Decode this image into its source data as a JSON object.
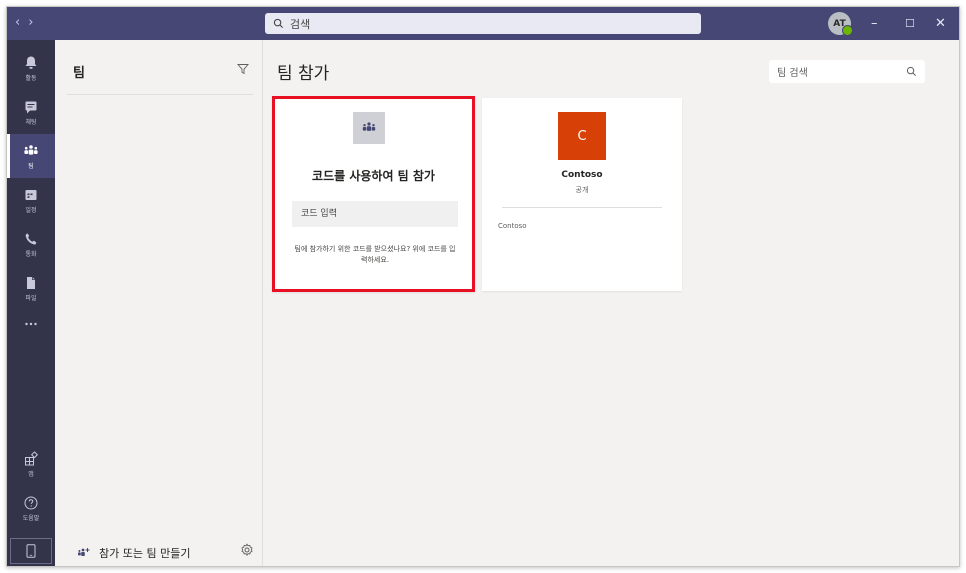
{
  "titlebar": {
    "search_placeholder": "검색",
    "avatar_initials": "AT"
  },
  "rail": {
    "items": [
      {
        "label": "활동",
        "icon": "bell-icon"
      },
      {
        "label": "채팅",
        "icon": "chat-icon"
      },
      {
        "label": "팀",
        "icon": "teams-icon",
        "active": true
      },
      {
        "label": "일정",
        "icon": "calendar-icon"
      },
      {
        "label": "통화",
        "icon": "phone-icon"
      },
      {
        "label": "파일",
        "icon": "file-icon"
      },
      {
        "label": "",
        "icon": "more-icon"
      },
      {
        "label": "앱",
        "icon": "apps-icon"
      },
      {
        "label": "도움말",
        "icon": "help-icon"
      }
    ]
  },
  "list": {
    "title": "팀",
    "join_create_label": "참가 또는 팀 만들기"
  },
  "main": {
    "title": "팀 참가",
    "team_search_placeholder": "팀 검색",
    "code_card": {
      "title": "코드를 사용하여 팀 참가",
      "input_placeholder": "코드 입력",
      "help_text": "팀에 참가하기 위한 코드를 받으셨나요? 위에 코드를 입력하세요."
    },
    "team_card": {
      "initial": "C",
      "name": "Contoso",
      "privacy": "공개",
      "description": "Contoso",
      "color": "#d74108"
    }
  },
  "colors": {
    "titlebar": "#464775",
    "rail": "#33344a",
    "highlight": "#e81123"
  }
}
